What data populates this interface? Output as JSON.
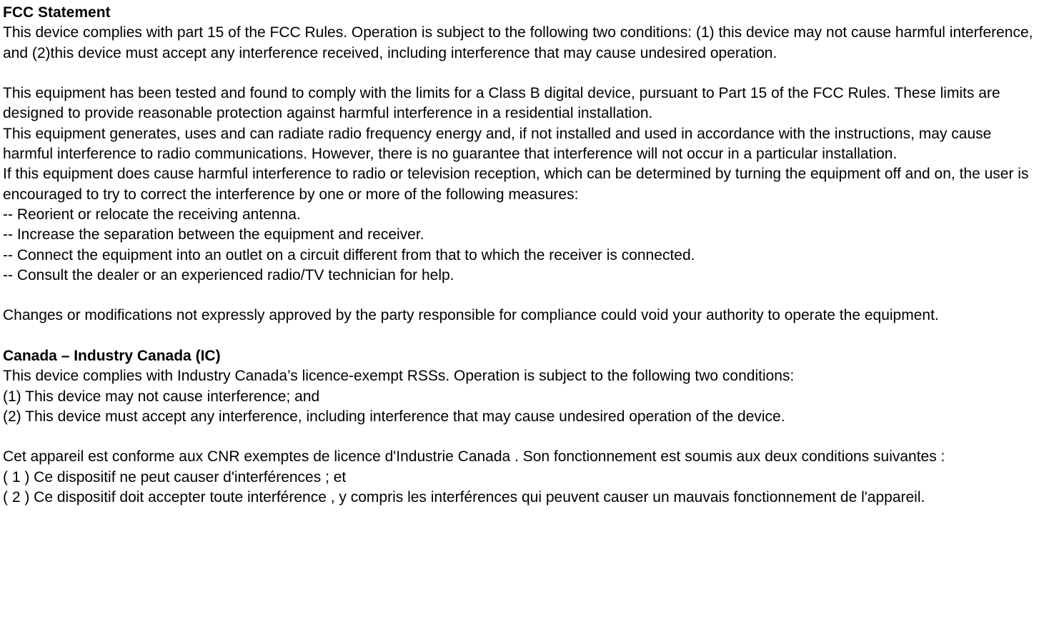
{
  "fcc": {
    "heading": "FCC Statement",
    "p1": "This device complies with part 15 of the FCC Rules. Operation is subject to the following two conditions: (1) this device may not cause harmful interference, and (2)this device must accept any interference received, including interference that may cause undesired operation.",
    "p2a": "This equipment has been tested and found to comply with the limits for a Class B digital device, pursuant to Part 15 of the FCC Rules. These limits are designed to provide reasonable protection against harmful interference in a residential installation.",
    "p2b": "This equipment generates, uses and can radiate radio frequency energy and, if not installed and used in accordance with the instructions, may cause harmful interference to radio communications. However, there is no guarantee that interference will not occur in a particular installation.",
    "p2c": "If this equipment does cause harmful interference to radio or television reception, which can be determined by turning the equipment off and on, the user is encouraged to try to correct the interference by one or more of the following measures:",
    "bullets": [
      "-- Reorient or relocate the receiving antenna.",
      "-- Increase the separation between the equipment and receiver.",
      "-- Connect the equipment into an outlet on a circuit different from that to which the receiver is connected.",
      "-- Consult the dealer or an experienced radio/TV technician for help."
    ],
    "p3": "Changes or modifications not expressly approved by the party responsible for compliance could void your authority to operate the equipment."
  },
  "ic": {
    "heading": "Canada – Industry Canada (IC)",
    "p1": "This device complies with Industry Canada’s licence-exempt RSSs. Operation is subject to the following two conditions:",
    "cond1": "(1) This device may not cause interference; and",
    "cond2": "(2) This device must accept any interference, including interference that may cause undesired operation of the device.",
    "p2": "Cet appareil est conforme aux CNR exemptes de licence d'Industrie Canada . Son fonctionnement est soumis aux deux conditions suivantes :",
    "cond1fr": "( 1 ) Ce dispositif ne peut causer d'interférences ; et",
    "cond2fr": "( 2 ) Ce dispositif doit accepter toute interférence , y compris les interférences qui peuvent causer un mauvais fonctionnement de l'appareil."
  }
}
